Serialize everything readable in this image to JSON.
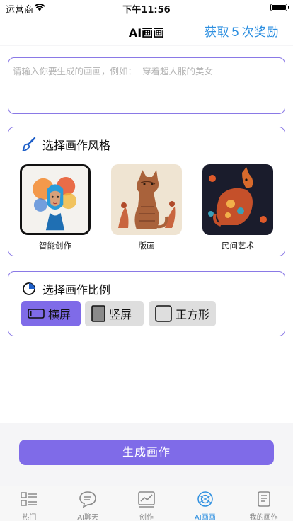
{
  "status_bar": {
    "carrier": "运营商",
    "time": "下午11:56"
  },
  "nav": {
    "title": "AI画画",
    "reward_label": "获取５次奖励"
  },
  "prompt": {
    "placeholder": "请输入你要生成的画画，例如：  穿着超人服的美女",
    "value": ""
  },
  "style_section": {
    "title": "选择画作风格",
    "icon": "brush-icon",
    "items": [
      {
        "label": "智能创作",
        "selected": true
      },
      {
        "label": "版画",
        "selected": false
      },
      {
        "label": "民间艺术",
        "selected": false
      }
    ]
  },
  "ratio_section": {
    "title": "选择画作比例",
    "icon": "pie-chart-icon",
    "options": [
      {
        "label": "横屏",
        "active": true
      },
      {
        "label": "竖屏",
        "active": false
      },
      {
        "label": "正方形",
        "active": false
      }
    ]
  },
  "generate_button": "生成画作",
  "tabs": [
    {
      "label": "热门",
      "icon": "list-grid-icon",
      "active": false
    },
    {
      "label": "AI聊天",
      "icon": "chat-bubble-icon",
      "active": false
    },
    {
      "label": "创作",
      "icon": "chart-board-icon",
      "active": false
    },
    {
      "label": "AI画画",
      "icon": "ai-paint-icon",
      "active": true
    },
    {
      "label": "我的画作",
      "icon": "notebook-icon",
      "active": false
    }
  ],
  "colors": {
    "accent": "#7f6be8",
    "link": "#2d8fe0",
    "border": "#8a79e6"
  }
}
